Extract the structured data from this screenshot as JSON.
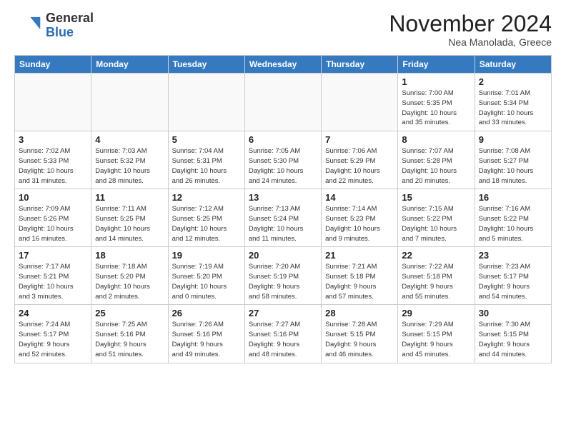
{
  "header": {
    "logo_general": "General",
    "logo_blue": "Blue",
    "month_title": "November 2024",
    "subtitle": "Nea Manolada, Greece"
  },
  "days_of_week": [
    "Sunday",
    "Monday",
    "Tuesday",
    "Wednesday",
    "Thursday",
    "Friday",
    "Saturday"
  ],
  "weeks": [
    [
      {
        "day": "",
        "info": ""
      },
      {
        "day": "",
        "info": ""
      },
      {
        "day": "",
        "info": ""
      },
      {
        "day": "",
        "info": ""
      },
      {
        "day": "",
        "info": ""
      },
      {
        "day": "1",
        "info": "Sunrise: 7:00 AM\nSunset: 5:35 PM\nDaylight: 10 hours\nand 35 minutes."
      },
      {
        "day": "2",
        "info": "Sunrise: 7:01 AM\nSunset: 5:34 PM\nDaylight: 10 hours\nand 33 minutes."
      }
    ],
    [
      {
        "day": "3",
        "info": "Sunrise: 7:02 AM\nSunset: 5:33 PM\nDaylight: 10 hours\nand 31 minutes."
      },
      {
        "day": "4",
        "info": "Sunrise: 7:03 AM\nSunset: 5:32 PM\nDaylight: 10 hours\nand 28 minutes."
      },
      {
        "day": "5",
        "info": "Sunrise: 7:04 AM\nSunset: 5:31 PM\nDaylight: 10 hours\nand 26 minutes."
      },
      {
        "day": "6",
        "info": "Sunrise: 7:05 AM\nSunset: 5:30 PM\nDaylight: 10 hours\nand 24 minutes."
      },
      {
        "day": "7",
        "info": "Sunrise: 7:06 AM\nSunset: 5:29 PM\nDaylight: 10 hours\nand 22 minutes."
      },
      {
        "day": "8",
        "info": "Sunrise: 7:07 AM\nSunset: 5:28 PM\nDaylight: 10 hours\nand 20 minutes."
      },
      {
        "day": "9",
        "info": "Sunrise: 7:08 AM\nSunset: 5:27 PM\nDaylight: 10 hours\nand 18 minutes."
      }
    ],
    [
      {
        "day": "10",
        "info": "Sunrise: 7:09 AM\nSunset: 5:26 PM\nDaylight: 10 hours\nand 16 minutes."
      },
      {
        "day": "11",
        "info": "Sunrise: 7:11 AM\nSunset: 5:25 PM\nDaylight: 10 hours\nand 14 minutes."
      },
      {
        "day": "12",
        "info": "Sunrise: 7:12 AM\nSunset: 5:25 PM\nDaylight: 10 hours\nand 12 minutes."
      },
      {
        "day": "13",
        "info": "Sunrise: 7:13 AM\nSunset: 5:24 PM\nDaylight: 10 hours\nand 11 minutes."
      },
      {
        "day": "14",
        "info": "Sunrise: 7:14 AM\nSunset: 5:23 PM\nDaylight: 10 hours\nand 9 minutes."
      },
      {
        "day": "15",
        "info": "Sunrise: 7:15 AM\nSunset: 5:22 PM\nDaylight: 10 hours\nand 7 minutes."
      },
      {
        "day": "16",
        "info": "Sunrise: 7:16 AM\nSunset: 5:22 PM\nDaylight: 10 hours\nand 5 minutes."
      }
    ],
    [
      {
        "day": "17",
        "info": "Sunrise: 7:17 AM\nSunset: 5:21 PM\nDaylight: 10 hours\nand 3 minutes."
      },
      {
        "day": "18",
        "info": "Sunrise: 7:18 AM\nSunset: 5:20 PM\nDaylight: 10 hours\nand 2 minutes."
      },
      {
        "day": "19",
        "info": "Sunrise: 7:19 AM\nSunset: 5:20 PM\nDaylight: 10 hours\nand 0 minutes."
      },
      {
        "day": "20",
        "info": "Sunrise: 7:20 AM\nSunset: 5:19 PM\nDaylight: 9 hours\nand 58 minutes."
      },
      {
        "day": "21",
        "info": "Sunrise: 7:21 AM\nSunset: 5:18 PM\nDaylight: 9 hours\nand 57 minutes."
      },
      {
        "day": "22",
        "info": "Sunrise: 7:22 AM\nSunset: 5:18 PM\nDaylight: 9 hours\nand 55 minutes."
      },
      {
        "day": "23",
        "info": "Sunrise: 7:23 AM\nSunset: 5:17 PM\nDaylight: 9 hours\nand 54 minutes."
      }
    ],
    [
      {
        "day": "24",
        "info": "Sunrise: 7:24 AM\nSunset: 5:17 PM\nDaylight: 9 hours\nand 52 minutes."
      },
      {
        "day": "25",
        "info": "Sunrise: 7:25 AM\nSunset: 5:16 PM\nDaylight: 9 hours\nand 51 minutes."
      },
      {
        "day": "26",
        "info": "Sunrise: 7:26 AM\nSunset: 5:16 PM\nDaylight: 9 hours\nand 49 minutes."
      },
      {
        "day": "27",
        "info": "Sunrise: 7:27 AM\nSunset: 5:16 PM\nDaylight: 9 hours\nand 48 minutes."
      },
      {
        "day": "28",
        "info": "Sunrise: 7:28 AM\nSunset: 5:15 PM\nDaylight: 9 hours\nand 46 minutes."
      },
      {
        "day": "29",
        "info": "Sunrise: 7:29 AM\nSunset: 5:15 PM\nDaylight: 9 hours\nand 45 minutes."
      },
      {
        "day": "30",
        "info": "Sunrise: 7:30 AM\nSunset: 5:15 PM\nDaylight: 9 hours\nand 44 minutes."
      }
    ]
  ]
}
